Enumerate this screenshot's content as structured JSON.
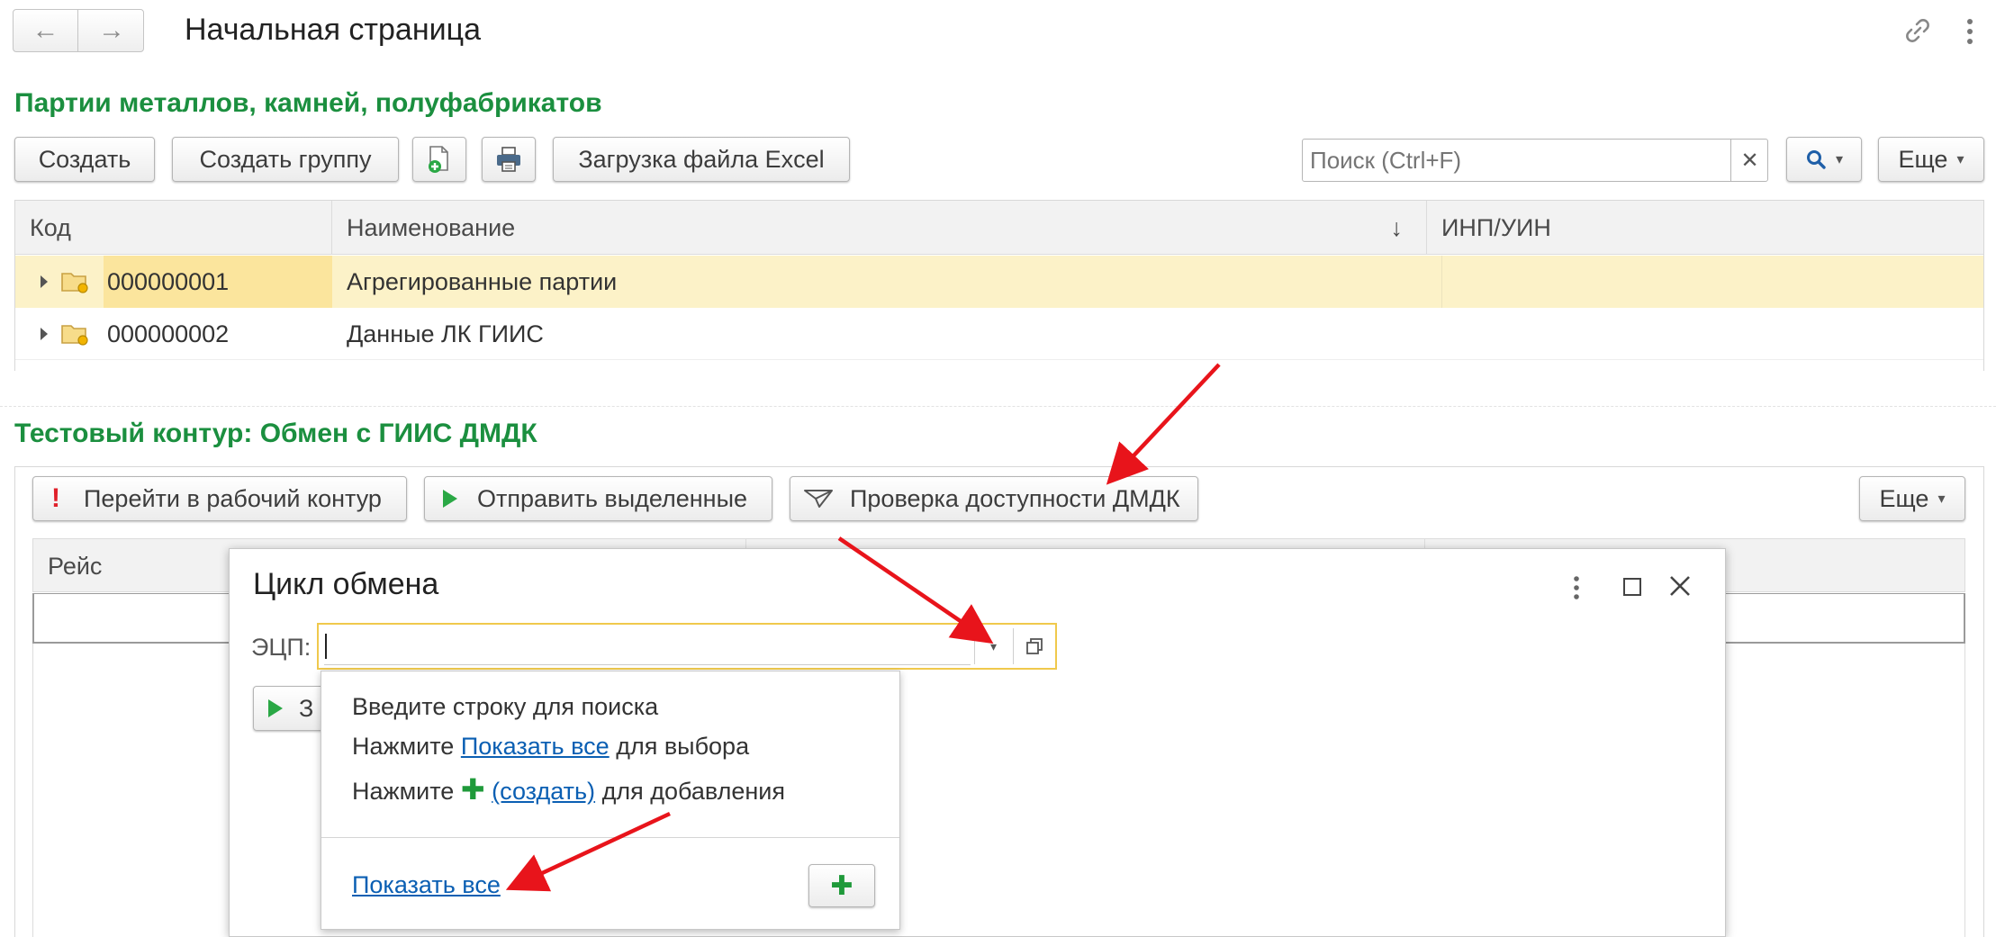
{
  "header": {
    "title": "Начальная страница"
  },
  "section1": {
    "title": "Партии металлов, камней, полуфабрикатов",
    "toolbar": {
      "create_label": "Создать",
      "create_group_label": "Создать группу",
      "excel_label": "Загрузка файла Excel",
      "more_label": "Еще"
    },
    "search": {
      "placeholder": "Поиск (Ctrl+F)",
      "value": ""
    },
    "table": {
      "columns": [
        "Код",
        "Наименование",
        "ИНП/УИН"
      ],
      "sort_indicator": "↓",
      "rows": [
        {
          "code": "000000001",
          "name": "Агрегированные партии",
          "inp": "",
          "selected": true
        },
        {
          "code": "000000002",
          "name": "Данные ЛК ГИИС",
          "inp": "",
          "selected": false
        }
      ]
    }
  },
  "section2": {
    "title": "Тестовый контур: Обмен с ГИИС ДМДК",
    "toolbar": {
      "goto_work_label": "Перейти в рабочий контур",
      "send_selected_label": "Отправить выделенные",
      "check_label": "Проверка доступности ДМДК",
      "more_label": "Еще"
    },
    "table": {
      "columns": [
        "Рейс"
      ]
    }
  },
  "dialog": {
    "title": "Цикл обмена",
    "ecp_label": "ЭЦП:",
    "ecp_value": "",
    "hidden_button_fragment": "З",
    "dropdown": {
      "line1": "Введите строку для поиска",
      "line2_prefix": "Нажмите",
      "line2_link": "Показать все",
      "line2_suffix": "для выбора",
      "line3_prefix": "Нажмите",
      "line3_link": "(создать)",
      "line3_suffix": "для добавления",
      "show_all_link": "Показать все"
    }
  },
  "colors": {
    "section_title": "#1b8f3f",
    "selected_row": "#fcf2c8",
    "selected_cell": "#fbe59d",
    "link": "#0b5fb3",
    "focus_border": "#f0c94c",
    "annotation_arrow": "#e8141b"
  }
}
